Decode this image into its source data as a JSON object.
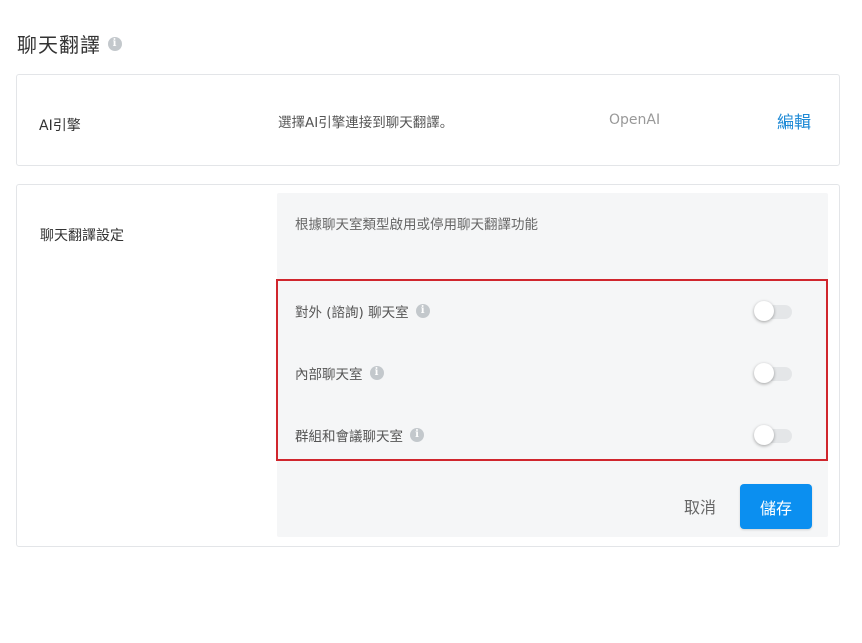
{
  "page": {
    "title": "聊天翻譯"
  },
  "ai_engine": {
    "label": "AI引擎",
    "description": "選擇AI引擎連接到聊天翻譯。",
    "engine": "OpenAI",
    "edit_label": "編輯"
  },
  "settings": {
    "label": "聊天翻譯設定",
    "description": "根據聊天室類型啟用或停用聊天翻譯功能",
    "toggles": [
      {
        "label": "對外 (諮詢) 聊天室",
        "enabled": false
      },
      {
        "label": "內部聊天室",
        "enabled": false
      },
      {
        "label": "群組和會議聊天室",
        "enabled": false
      }
    ],
    "cancel_label": "取消",
    "save_label": "儲存"
  },
  "colors": {
    "accent": "#1e8ad6",
    "primary_button": "#0b8ff0",
    "highlight_border": "#d0262d"
  }
}
